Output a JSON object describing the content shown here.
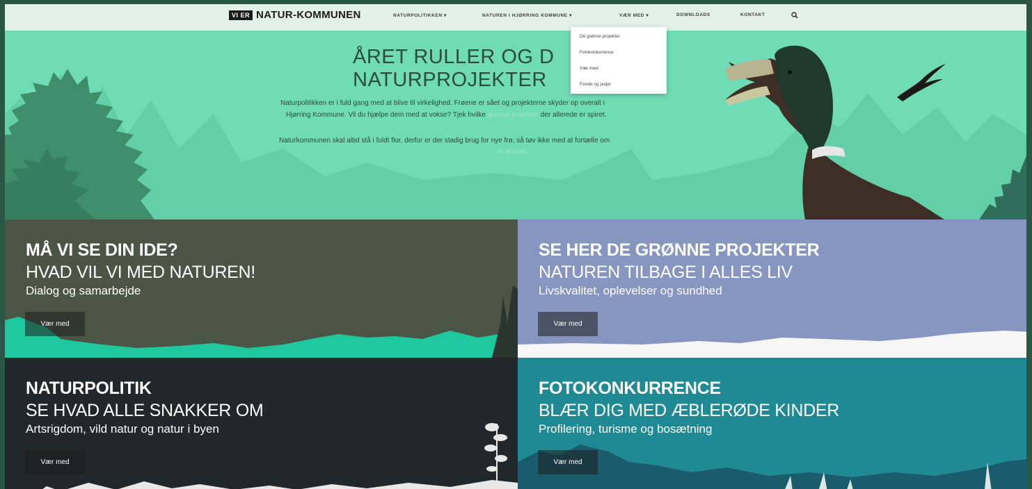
{
  "nav": {
    "logo_badge": "VI ER",
    "logo_text": "NATUR-KOMMUNEN",
    "items": [
      {
        "label": "NATURPOLITIKKEN ▾"
      },
      {
        "label": "NATUREN I HJØRRING KOMMUNE ▾"
      },
      {
        "label": "VÆR MED ▾"
      },
      {
        "label": "DOWNLOADS"
      },
      {
        "label": "KONTAKT"
      }
    ],
    "search_icon": "search-icon",
    "dropdown": [
      {
        "label": "De grønne projekter"
      },
      {
        "label": "Fotokonkurrence"
      },
      {
        "label": "Vær med"
      },
      {
        "label": "Fonde og puljer"
      }
    ]
  },
  "hero": {
    "title_line1": "ÅRET RULLER OG D",
    "title_line2": "NATURPROJEKTER",
    "p1_line1": "Naturpolitikken er i fuld gang med at blive til virkelighed. Frøene er sået og projekterne skyder op overalt i",
    "p1_line2_a": "Hjørring Kommune. Vil du hjælpe dem med at vokse? Tjek hvilke",
    "p1_line2_link": "grønne projekter",
    "p1_line2_b": "der allerede er spiret.",
    "p2_line1": "Naturkommunen skal altid stå i fuldt flor, derfor er der stadig brug for nye frø, så tøv ikke med at fortælle om",
    "p2_link": "dit projekt."
  },
  "panels": [
    {
      "h1": "MÅ VI SE DIN IDE?",
      "h2": "HVAD VIL VI MED NATUREN!",
      "h3": "Dialog og samarbejde",
      "button": "Vær med",
      "bg": "#4a5545"
    },
    {
      "h1": "SE HER DE GRØNNE PROJEKTER",
      "h2": "NATUREN TILBAGE I ALLES LIV",
      "h3": "Livskvalitet, oplevelser og sundhed",
      "button": "Vær med",
      "bg": "#8796c1"
    },
    {
      "h1": "NATURPOLITIK",
      "h2": "SE HVAD ALLE SNAKKER OM",
      "h3": "Artsrigdom, vild natur og natur i byen",
      "button": "Vær med",
      "bg": "#22272b"
    },
    {
      "h1": "FOTOKONKURRENCE",
      "h2": "BLÆR DIG MED ÆBLERØDE KINDER",
      "h3": "Profilering, turisme og bosætning",
      "button": "Vær med",
      "bg": "#1f8a93"
    }
  ]
}
